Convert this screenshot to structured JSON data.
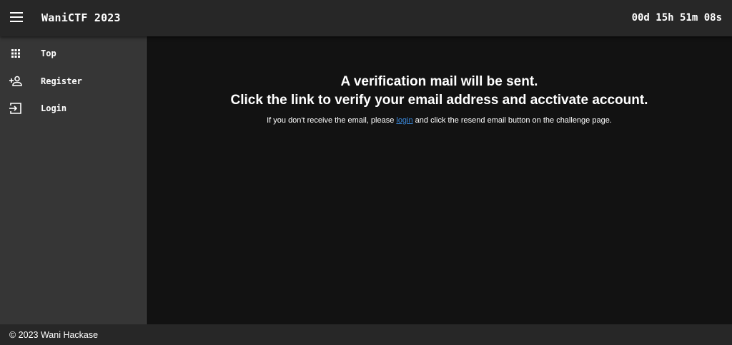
{
  "header": {
    "menu_icon": "menu-icon",
    "title": "WaniCTF 2023",
    "countdown": "00d 15h 51m 08s"
  },
  "sidebar": {
    "items": [
      {
        "label": "Top",
        "icon": "grid-icon"
      },
      {
        "label": "Register",
        "icon": "person-add-icon"
      },
      {
        "label": "Login",
        "icon": "login-icon"
      }
    ]
  },
  "main": {
    "heading_line1": "A verification mail will be sent.",
    "heading_line2": "Click the link to verify your email address and acctivate account.",
    "note_before": "If you don't receive the email, please ",
    "note_link": "login",
    "note_after": " and click the resend email button on the challenge page."
  },
  "footer": {
    "copyright": "© 2023 Wani Hackase"
  },
  "colors": {
    "header_bg": "#272727",
    "sidebar_bg": "#363636",
    "main_bg": "#121212",
    "link": "#3a87d8"
  }
}
